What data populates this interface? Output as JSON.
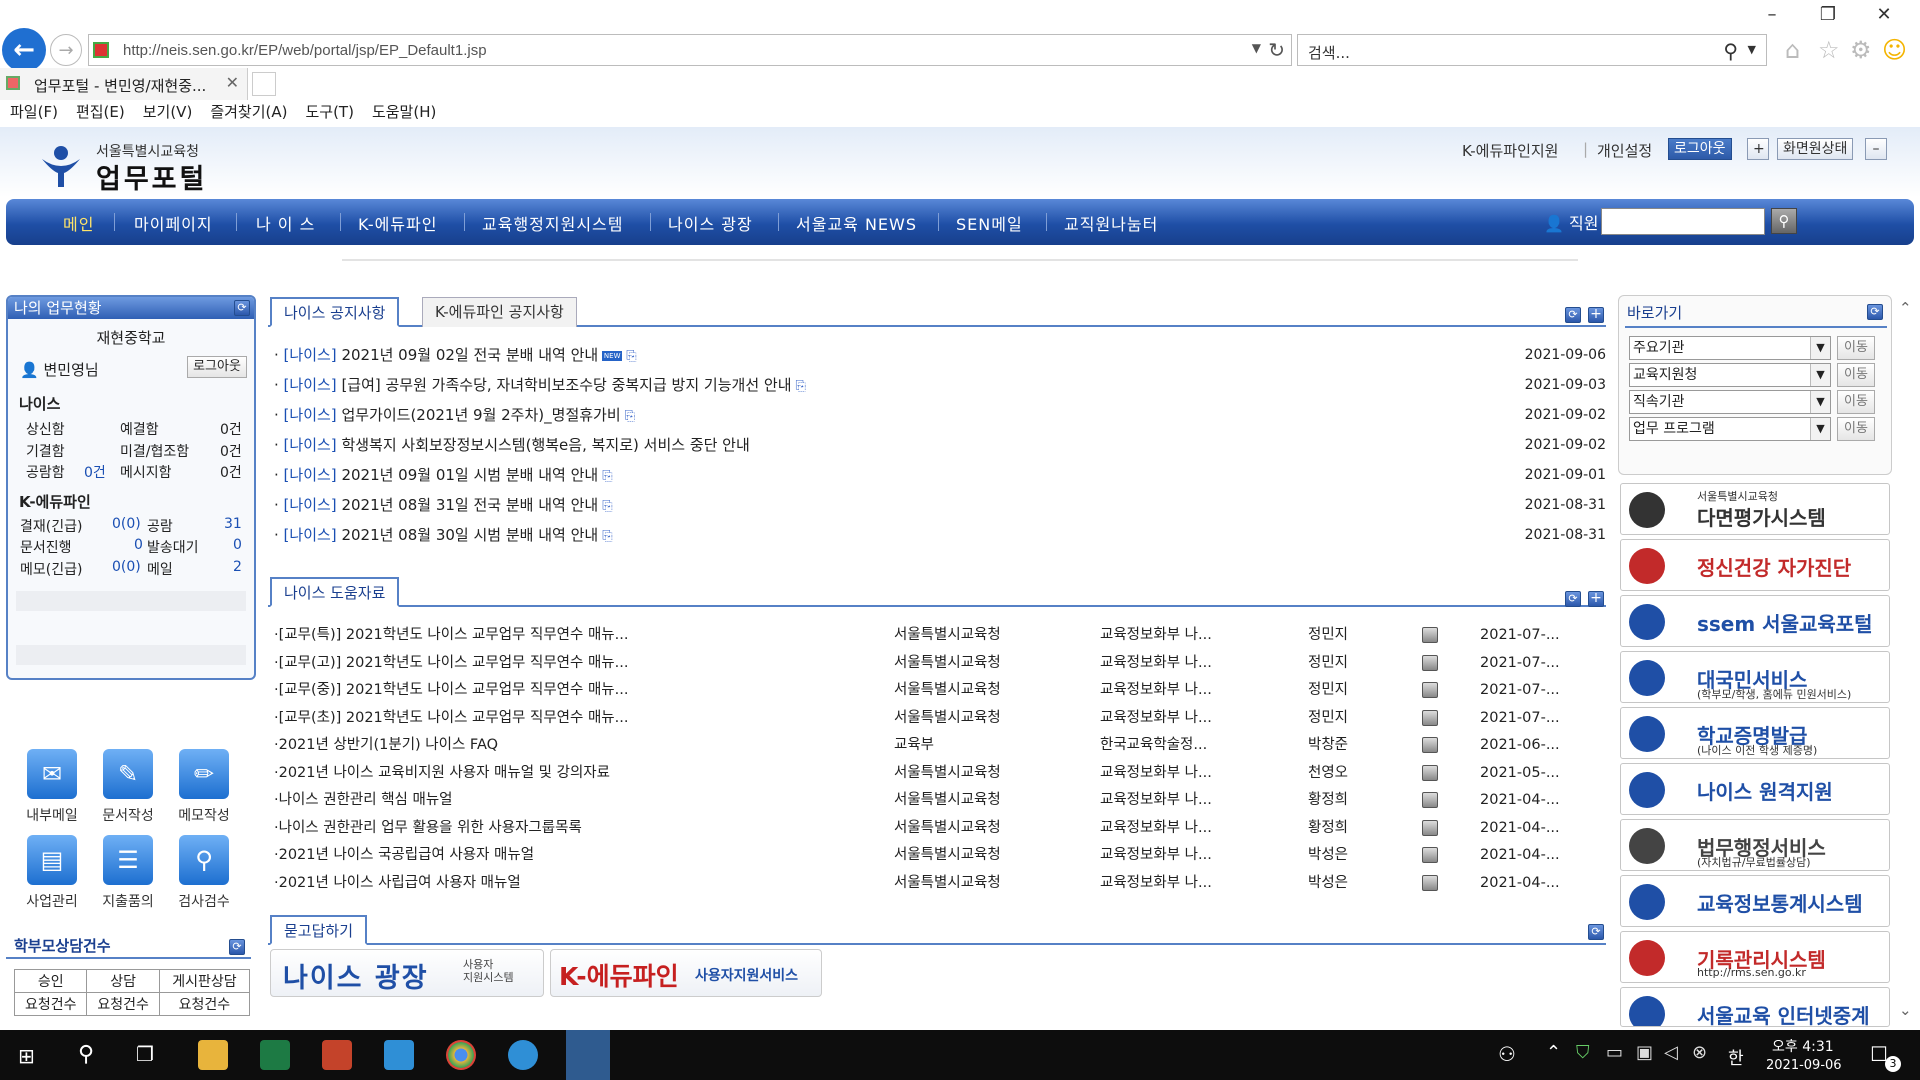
{
  "browser": {
    "url": "http://neis.sen.go.kr/EP/web/portal/jsp/EP_Default1.jsp",
    "search_placeholder": "검색...",
    "tab_title": "업무포털 - 변민영/재현중...",
    "menu": [
      "파일(F)",
      "편집(E)",
      "보기(V)",
      "즐겨찾기(A)",
      "도구(T)",
      "도움말(H)"
    ]
  },
  "header": {
    "logo_sub": "서울특별시교육청",
    "logo_main": "업무포털",
    "util_links": [
      "K-에듀파인지원",
      "개인설정"
    ],
    "logout": "로그아웃",
    "screen_state": "화면원상태"
  },
  "gnb": {
    "items": [
      "메인",
      "마이페이지",
      "나 이 스",
      "K-에듀파인",
      "교육행정지원시스템",
      "나이스 광장",
      "서울교육 NEWS",
      "SEN메일",
      "교직원나눔터"
    ],
    "staff_label": "직원"
  },
  "my_work": {
    "title": "나의 업무현황",
    "school": "재현중학교",
    "user": "변민영님",
    "logout": "로그아웃",
    "neis_title": "나이스",
    "neis_rows": [
      {
        "a": "상신함",
        "b": "예결함",
        "v": "0건"
      },
      {
        "a": "기결함",
        "b": "미결/협조함",
        "v": "0건"
      },
      {
        "a": "공람함",
        "av": "0건",
        "b": "메시지함",
        "v": "0건"
      }
    ],
    "edufine_title": "K-에듀파인",
    "edufine_rows": [
      {
        "a": "결재(긴급)",
        "av": "0(0)",
        "b": "공람",
        "v": "31"
      },
      {
        "a": "문서진행",
        "av": "0",
        "b": "발송대기",
        "v": "0"
      },
      {
        "a": "메모(긴급)",
        "av": "0(0)",
        "b": "메일",
        "v": "2"
      }
    ]
  },
  "quick_icons": [
    "내부메일",
    "문서작성",
    "메모작성",
    "사업관리",
    "지출품의",
    "검사검수"
  ],
  "parent_consult": {
    "title": "학부모상담건수",
    "headers": [
      [
        "승인",
        "요청건수"
      ],
      [
        "상담",
        "요청건수"
      ],
      [
        "게시판상담",
        "요청건수"
      ]
    ]
  },
  "notice": {
    "tabs": [
      "나이스 공지사항",
      "K-에듀파인 공지사항"
    ],
    "rows": [
      {
        "cat": "[나이스]",
        "title": "2021년 09월 02일 전국 분배 내역 안내",
        "new": "NEW",
        "clip": true,
        "date": "2021-09-06"
      },
      {
        "cat": "[나이스]",
        "title": "[급여] 공무원 가족수당, 자녀학비보조수당 중복지급 방지 기능개선 안내",
        "clip": true,
        "date": "2021-09-03"
      },
      {
        "cat": "[나이스]",
        "title": "업무가이드(2021년 9월 2주차)_명절휴가비",
        "clip": true,
        "date": "2021-09-02"
      },
      {
        "cat": "[나이스]",
        "title": "학생복지 사회보장정보시스템(행복e음, 복지로) 서비스 중단 안내",
        "clip": false,
        "date": "2021-09-02"
      },
      {
        "cat": "[나이스]",
        "title": "2021년 09월 01일 시범 분배 내역 안내",
        "clip": true,
        "date": "2021-09-01"
      },
      {
        "cat": "[나이스]",
        "title": "2021년 08월 31일 전국 분배 내역 안내",
        "clip": true,
        "date": "2021-08-31"
      },
      {
        "cat": "[나이스]",
        "title": "2021년 08월 30일 시범 분배 내역 안내",
        "clip": true,
        "date": "2021-08-31"
      }
    ]
  },
  "help": {
    "tab": "나이스 도움자료",
    "rows": [
      {
        "title": "[교무(특)] 2021학년도 나이스 교무업무 직무연수 매뉴...",
        "org": "서울특별시교육청",
        "dept": "교육정보화부 나...",
        "name": "정민지",
        "date": "2021-07-..."
      },
      {
        "title": "[교무(고)] 2021학년도 나이스 교무업무 직무연수 매뉴...",
        "org": "서울특별시교육청",
        "dept": "교육정보화부 나...",
        "name": "정민지",
        "date": "2021-07-..."
      },
      {
        "title": "[교무(중)] 2021학년도 나이스 교무업무 직무연수 매뉴...",
        "org": "서울특별시교육청",
        "dept": "교육정보화부 나...",
        "name": "정민지",
        "date": "2021-07-..."
      },
      {
        "title": "[교무(초)] 2021학년도 나이스 교무업무 직무연수 매뉴...",
        "org": "서울특별시교육청",
        "dept": "교육정보화부 나...",
        "name": "정민지",
        "date": "2021-07-..."
      },
      {
        "title": "2021년 상반기(1분기) 나이스 FAQ",
        "org": "교육부",
        "dept": "한국교육학술정...",
        "name": "박창준",
        "date": "2021-06-..."
      },
      {
        "title": "2021년 나이스 교육비지원 사용자 매뉴얼 및 강의자료",
        "org": "서울특별시교육청",
        "dept": "교육정보화부 나...",
        "name": "천영오",
        "date": "2021-05-..."
      },
      {
        "title": "나이스 권한관리 핵심 매뉴얼",
        "org": "서울특별시교육청",
        "dept": "교육정보화부 나...",
        "name": "황정희",
        "date": "2021-04-..."
      },
      {
        "title": "나이스 권한관리 업무 활용을 위한 사용자그룹목록",
        "org": "서울특별시교육청",
        "dept": "교육정보화부 나...",
        "name": "황정희",
        "date": "2021-04-..."
      },
      {
        "title": "2021년 나이스 국공립급여 사용자 매뉴얼",
        "org": "서울특별시교육청",
        "dept": "교육정보화부 나...",
        "name": "박성은",
        "date": "2021-04-..."
      },
      {
        "title": "2021년 나이스 사립급여 사용자 매뉴얼",
        "org": "서울특별시교육청",
        "dept": "교육정보화부 나...",
        "name": "박성은",
        "date": "2021-04-..."
      }
    ]
  },
  "qa": {
    "tab": "묻고답하기",
    "banner1_main": "나이스 광장",
    "banner1_sub": "사용자\n지원시스템",
    "banner2_main": "K-에듀파인",
    "banner2_sub": "사용자지원서비스"
  },
  "shortcut": {
    "title": "바로가기",
    "selects": [
      "주요기관",
      "교육지원청",
      "직속기관",
      "업무 프로그램"
    ],
    "go": "이동"
  },
  "right_banners": [
    {
      "sub": "서울특별시교육청",
      "main": "다면평가시스템",
      "color": "#333333"
    },
    {
      "sub": "",
      "main": "정신건강 자가진단",
      "color": "#c22a2a"
    },
    {
      "sub": "",
      "main": "ssem 서울교육포털",
      "color": "#1f4fa6"
    },
    {
      "sub": "(학부모/학생, 홈에듀 민원서비스)",
      "main": "대국민서비스",
      "color": "#1f4fa6"
    },
    {
      "sub": "(나이스 이전 학생 제증명)",
      "main": "학교증명발급",
      "color": "#1f4fa6"
    },
    {
      "sub": "",
      "main": "나이스 원격지원",
      "color": "#1f4fa6"
    },
    {
      "sub": "(자치법규/무료법률상담)",
      "main": "법무행정서비스",
      "color": "#444444"
    },
    {
      "sub": "",
      "main": "교육정보통계시스템",
      "color": "#1f4fa6"
    },
    {
      "sub": "http://rms.sen.go.kr",
      "main": "기록관리시스템",
      "color": "#c22a2a"
    },
    {
      "sub": "",
      "main": "서울교육 인터넷중계",
      "color": "#1f4fa6"
    }
  ],
  "taskbar": {
    "ime": "한",
    "time": "오후 4:31",
    "date": "2021-09-06",
    "notif": "3"
  }
}
